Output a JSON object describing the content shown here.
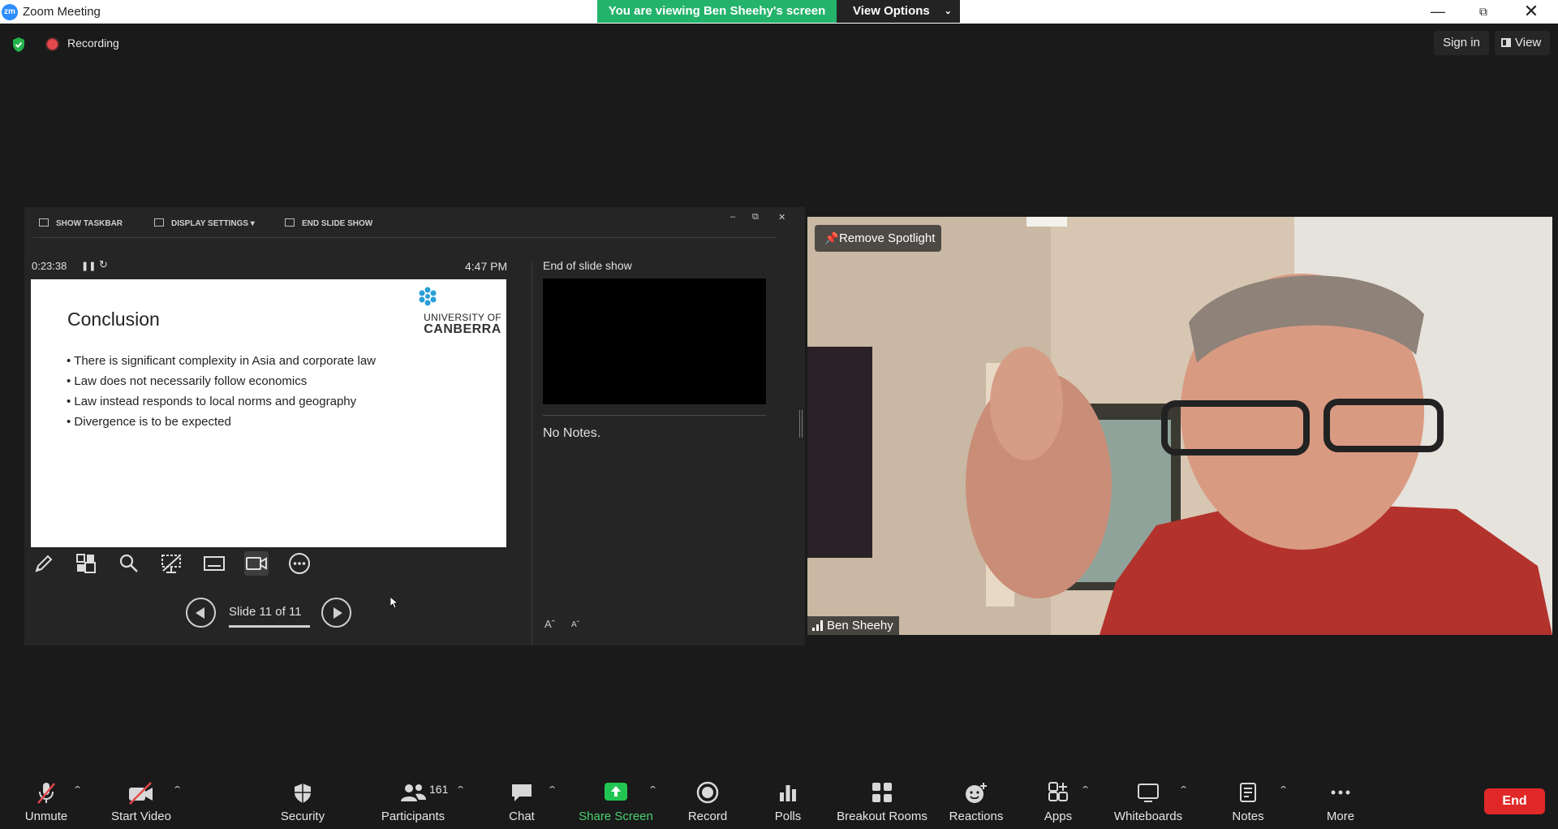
{
  "window": {
    "app_icon": "zm",
    "title": "Zoom Meeting",
    "viewing_banner": "You are viewing Ben Sheehy's screen",
    "view_options": "View Options",
    "controls": [
      "minimize-icon",
      "restore-icon",
      "close-icon"
    ]
  },
  "meeting": {
    "recording_label": "Recording",
    "sign_in": "Sign in",
    "view": "View"
  },
  "presenter": {
    "toolbar": {
      "show_taskbar": "SHOW TASKBAR",
      "display_settings": "DISPLAY SETTINGS ▾",
      "end_slide_show": "END SLIDE SHOW"
    },
    "timer": "0:23:38",
    "clock": "4:47 PM",
    "slide": {
      "title": "Conclusion",
      "logo_line1": "UNIVERSITY OF",
      "logo_line2": "CANBERRA",
      "bullets": [
        "There is significant complexity in Asia and corporate law",
        "Law does not necessarily follow economics",
        "Law instead responds to local norms and geography",
        "Divergence is to be expected"
      ]
    },
    "next_label": "End of slide show",
    "notes": "No Notes.",
    "font_increase": "Aˆ",
    "font_decrease": "Aˇ",
    "slide_counter": "Slide 11 of 11"
  },
  "video": {
    "remove_spotlight": "Remove Spotlight",
    "participant_name": "Ben Sheehy"
  },
  "toolbar": {
    "unmute": "Unmute",
    "start_video": "Start Video",
    "security": "Security",
    "participants": "Participants",
    "participants_count": "161",
    "chat": "Chat",
    "share_screen": "Share Screen",
    "record": "Record",
    "polls": "Polls",
    "breakout_rooms": "Breakout Rooms",
    "reactions": "Reactions",
    "apps": "Apps",
    "whiteboards": "Whiteboards",
    "notes": "Notes",
    "more": "More",
    "end": "End"
  },
  "colors": {
    "banner_green": "#24b36b",
    "share_green": "#4ad16f",
    "end_red": "#e02828",
    "zoom_blue": "#2D8CFF"
  }
}
